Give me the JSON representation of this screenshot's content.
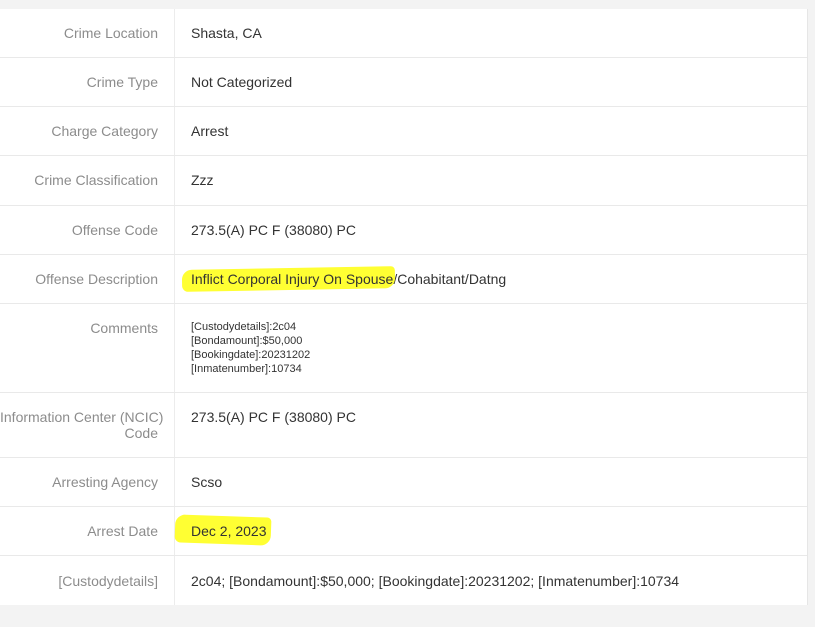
{
  "details": {
    "crime_location": {
      "label": "Crime Location",
      "value": "Shasta, CA"
    },
    "crime_type": {
      "label": "Crime Type",
      "value": "Not Categorized"
    },
    "charge_category": {
      "label": "Charge Category",
      "value": "Arrest"
    },
    "crime_classification": {
      "label": "Crime Classification",
      "value": "Zzz"
    },
    "offense_code": {
      "label": "Offense Code",
      "value": "273.5(A) PC F (38080) PC"
    },
    "offense_description": {
      "label": "Offense Description",
      "value_highlighted": "Inflict Corporal Injury On Spouse",
      "value_rest": "/Cohabitant/Datng"
    },
    "comments": {
      "label": "Comments",
      "lines": [
        "[Custodydetails]:2c04",
        "[Bondamount]:$50,000",
        "[Bookingdate]:20231202",
        "[Inmatenumber]:10734"
      ]
    },
    "ncic_code": {
      "label_line1": "Information Center (NCIC)",
      "label_line2": "Code",
      "value": "273.5(A) PC F (38080) PC"
    },
    "arresting_agency": {
      "label": "Arresting Agency",
      "value": "Scso"
    },
    "arrest_date": {
      "label": "Arrest Date",
      "value": "Dec 2, 2023"
    },
    "custody_details": {
      "label": "[Custodydetails]",
      "value": "2c04; [Bondamount]:$50,000; [Bookingdate]:20231202; [Inmatenumber]:10734"
    }
  },
  "colors": {
    "highlight": "#ffff33",
    "label": "#8c8c8c",
    "value": "#333333",
    "background": "#f3f3f3"
  }
}
